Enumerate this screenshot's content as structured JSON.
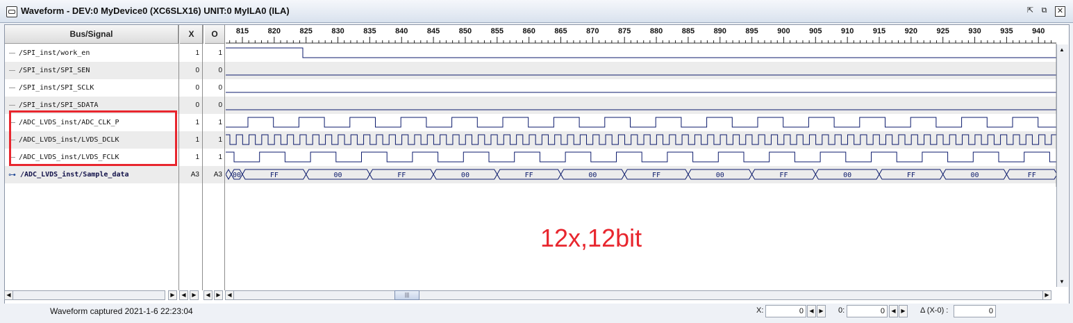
{
  "window": {
    "title": "Waveform - DEV:0 MyDevice0 (XC6SLX16) UNIT:0 MyILA0 (ILA)",
    "controls": [
      "dock",
      "maximize",
      "close"
    ]
  },
  "columns": {
    "bus_signal": "Bus/Signal",
    "x": "X",
    "o": "O"
  },
  "timeline": {
    "ticks": [
      "815",
      "820",
      "825",
      "830",
      "835",
      "840",
      "845",
      "850",
      "855",
      "860",
      "865",
      "870",
      "875",
      "880",
      "885",
      "890",
      "895",
      "900",
      "905",
      "910",
      "915",
      "920",
      "925",
      "930",
      "935",
      "940"
    ]
  },
  "signals": [
    {
      "name": "/SPI_inst/work_en",
      "x": "1",
      "o": "1"
    },
    {
      "name": "/SPI_inst/SPI_SEN",
      "x": "0",
      "o": "0"
    },
    {
      "name": "/SPI_inst/SPI_SCLK",
      "x": "0",
      "o": "0"
    },
    {
      "name": "/SPI_inst/SPI_SDATA",
      "x": "0",
      "o": "0"
    },
    {
      "name": "/ADC_LVDS_inst/ADC_CLK_P",
      "x": "1",
      "o": "1"
    },
    {
      "name": "/ADC_LVDS_inst/LVDS_DCLK",
      "x": "1",
      "o": "1"
    },
    {
      "name": "/ADC_LVDS_inst/LVDS_FCLK",
      "x": "1",
      "o": "1"
    },
    {
      "name": "/ADC_LVDS_inst/Sample_data",
      "x": "A3",
      "o": "A3"
    }
  ],
  "bus_values": [
    "A3",
    "00",
    "FF",
    "00",
    "FF",
    "00",
    "FF",
    "00",
    "FF",
    "00",
    "FF",
    "00",
    "FF",
    "00",
    "FF"
  ],
  "annotation": "12x,12bit",
  "status": {
    "message": "Waveform captured 2021-1-6 22:23:04",
    "x_label": "X:",
    "x_value": "0",
    "o_label": "0:",
    "o_value": "0",
    "delta_label": "Δ (X-0) :",
    "delta_value": "0"
  },
  "colors": {
    "waveform": "#0b1a6b",
    "highlight": "#e8262e",
    "grid": "#cfcfcf"
  }
}
